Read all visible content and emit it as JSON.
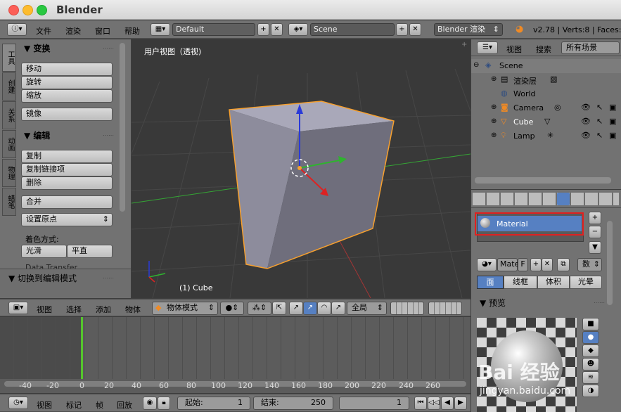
{
  "window": {
    "title": "Blender"
  },
  "info_header": {
    "menus": [
      "文件",
      "渲染",
      "窗口",
      "帮助"
    ],
    "layout": "Default",
    "scene": "Scene",
    "engine": "Blender 渲染",
    "stats": "v2.78 | Verts:8 | Faces:6"
  },
  "tool_panel": {
    "tabs": [
      "工具",
      "创建",
      "关系",
      "动画",
      "物理",
      "蜡笔"
    ],
    "transform_title": "变换",
    "transform_buttons": [
      "移动",
      "旋转",
      "缩放"
    ],
    "mirror": "镜像",
    "edit_title": "编辑",
    "edit_buttons": [
      "复制",
      "复制链接项",
      "删除"
    ],
    "join": "合并",
    "set_origin": "设置原点",
    "shading_label": "着色方式:",
    "shading_smooth": "光滑",
    "shading_flat": "平直",
    "data_transfer": "Data Transfer",
    "operator_title": "切换到编辑模式"
  },
  "viewport": {
    "label": "用户视图（透视)",
    "object_label": "(1) Cube"
  },
  "view3d_header": {
    "menus": [
      "视图",
      "选择",
      "添加",
      "物体"
    ],
    "mode": "物体模式",
    "orientation": "全局"
  },
  "outliner": {
    "menus": [
      "视图",
      "搜索"
    ],
    "filter": "所有场景",
    "items": [
      {
        "label": "Scene"
      },
      {
        "label": "渲染层"
      },
      {
        "label": "World"
      },
      {
        "label": "Camera"
      },
      {
        "label": "Cube"
      },
      {
        "label": "Lamp"
      }
    ]
  },
  "properties": {
    "material_slot": "Material",
    "material_name": "Mate",
    "material_f": "F",
    "data_label": "数",
    "tabs": [
      "面",
      "线框",
      "体积",
      "光晕"
    ],
    "preview_title": "预览"
  },
  "timeline": {
    "ticks": [
      "-40",
      "-20",
      "0",
      "20",
      "40",
      "60",
      "80",
      "100",
      "120",
      "140",
      "160",
      "180",
      "200",
      "220",
      "240",
      "260"
    ],
    "menus": [
      "视图",
      "标记",
      "帧",
      "回放"
    ],
    "start_label": "起始:",
    "start_value": "1",
    "end_label": "结束:",
    "end_value": "250",
    "current_frame": "1"
  },
  "watermark": {
    "text": "Bai 经验",
    "url": "jingyan.baidu.com"
  }
}
